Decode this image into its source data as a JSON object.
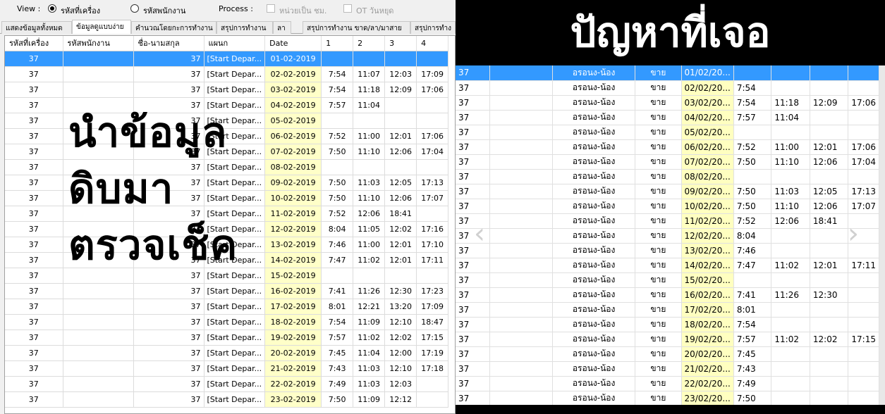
{
  "toolbar": {
    "view_label": "View :",
    "radio_machine": "รหัสที่เครื่อง",
    "radio_employee": "รหัสพนักงาน",
    "process_label": "Process :",
    "unit_hours": "หน่วยเป็น ชม.",
    "ot_holiday": "OT วันหยุด"
  },
  "tabs": [
    "แสดงข้อมูลทั้งหมด",
    "ข้อมูลดูแบบง่าย",
    "คำนวณโดยกะการทำงาน",
    "สรุปการทำงาน",
    "ลา",
    "สรุปการทำงาน ขาด/ลา/มาสาย",
    "สรุปการทำง"
  ],
  "grid": {
    "columns": [
      "รหัสที่เครื่อง",
      "รหัสพนักงาน",
      "ชื่อ-นามสกุล",
      "แผนก",
      "Date",
      "1",
      "2",
      "3",
      "4"
    ],
    "rows": [
      [
        "37",
        "",
        "37",
        "[Start Depar...",
        "01-02-2019",
        "",
        "",
        "",
        ""
      ],
      [
        "37",
        "",
        "37",
        "[Start Depar...",
        "02-02-2019",
        "7:54",
        "11:07",
        "12:03",
        "17:09"
      ],
      [
        "37",
        "",
        "37",
        "[Start Depar...",
        "03-02-2019",
        "7:54",
        "11:18",
        "12:09",
        "17:06"
      ],
      [
        "37",
        "",
        "37",
        "[Start Depar...",
        "04-02-2019",
        "7:57",
        "11:04",
        "",
        ""
      ],
      [
        "37",
        "",
        "37",
        "[Start Depar...",
        "05-02-2019",
        "",
        "",
        "",
        ""
      ],
      [
        "37",
        "",
        "37",
        "[Start Depar...",
        "06-02-2019",
        "7:52",
        "11:00",
        "12:01",
        "17:06"
      ],
      [
        "37",
        "",
        "37",
        "[Start Depar...",
        "07-02-2019",
        "7:50",
        "11:10",
        "12:06",
        "17:04"
      ],
      [
        "37",
        "",
        "37",
        "[Start Depar...",
        "08-02-2019",
        "",
        "",
        "",
        ""
      ],
      [
        "37",
        "",
        "37",
        "[Start Depar...",
        "09-02-2019",
        "7:50",
        "11:03",
        "12:05",
        "17:13"
      ],
      [
        "37",
        "",
        "37",
        "[Start Depar...",
        "10-02-2019",
        "7:50",
        "11:10",
        "12:06",
        "17:07"
      ],
      [
        "37",
        "",
        "37",
        "[Start Depar...",
        "11-02-2019",
        "7:52",
        "12:06",
        "18:41",
        ""
      ],
      [
        "37",
        "",
        "37",
        "[Start Depar...",
        "12-02-2019",
        "8:04",
        "11:05",
        "12:02",
        "17:16"
      ],
      [
        "37",
        "",
        "37",
        "[Start Depar...",
        "13-02-2019",
        "7:46",
        "11:00",
        "12:01",
        "17:10"
      ],
      [
        "37",
        "",
        "37",
        "[Start Depar...",
        "14-02-2019",
        "7:47",
        "11:02",
        "12:01",
        "17:11"
      ],
      [
        "37",
        "",
        "37",
        "[Start Depar...",
        "15-02-2019",
        "",
        "",
        "",
        ""
      ],
      [
        "37",
        "",
        "37",
        "[Start Depar...",
        "16-02-2019",
        "7:41",
        "11:26",
        "12:30",
        "17:23"
      ],
      [
        "37",
        "",
        "37",
        "[Start Depar...",
        "17-02-2019",
        "8:01",
        "12:21",
        "13:20",
        "17:09"
      ],
      [
        "37",
        "",
        "37",
        "[Start Depar...",
        "18-02-2019",
        "7:54",
        "11:09",
        "12:10",
        "18:47"
      ],
      [
        "37",
        "",
        "37",
        "[Start Depar...",
        "19-02-2019",
        "7:57",
        "11:02",
        "12:02",
        "17:15"
      ],
      [
        "37",
        "",
        "37",
        "[Start Depar...",
        "20-02-2019",
        "7:45",
        "11:04",
        "12:00",
        "17:19"
      ],
      [
        "37",
        "",
        "37",
        "[Start Depar...",
        "21-02-2019",
        "7:43",
        "11:03",
        "12:10",
        "17:18"
      ],
      [
        "37",
        "",
        "37",
        "[Start Depar...",
        "22-02-2019",
        "7:49",
        "11:03",
        "12:03",
        ""
      ],
      [
        "37",
        "",
        "37",
        "[Start Depar...",
        "23-02-2019",
        "7:50",
        "11:09",
        "12:12",
        ""
      ]
    ]
  },
  "overlay": {
    "line1": "นำข้อมูล",
    "line2": "ดิบมา",
    "line3": "ตรวจเช็ค"
  },
  "right": {
    "banner": "ปัญหาที่เจอ",
    "rows": [
      [
        "37",
        "",
        "อรอนง-น้อง",
        "ขาย",
        "01/02/20...",
        "",
        "",
        "",
        ""
      ],
      [
        "37",
        "",
        "อรอนง-น้อง",
        "ขาย",
        "02/02/20...",
        "7:54",
        "",
        "",
        ""
      ],
      [
        "37",
        "",
        "อรอนง-น้อง",
        "ขาย",
        "03/02/20...",
        "7:54",
        "11:18",
        "12:09",
        "17:06"
      ],
      [
        "37",
        "",
        "อรอนง-น้อง",
        "ขาย",
        "04/02/20...",
        "7:57",
        "11:04",
        "",
        ""
      ],
      [
        "37",
        "",
        "อรอนง-น้อง",
        "ขาย",
        "05/02/20...",
        "",
        "",
        "",
        ""
      ],
      [
        "37",
        "",
        "อรอนง-น้อง",
        "ขาย",
        "06/02/20...",
        "7:52",
        "11:00",
        "12:01",
        "17:06"
      ],
      [
        "37",
        "",
        "อรอนง-น้อง",
        "ขาย",
        "07/02/20...",
        "7:50",
        "11:10",
        "12:06",
        "17:04"
      ],
      [
        "37",
        "",
        "อรอนง-น้อง",
        "ขาย",
        "08/02/20...",
        "",
        "",
        "",
        ""
      ],
      [
        "37",
        "",
        "อรอนง-น้อง",
        "ขาย",
        "09/02/20...",
        "7:50",
        "11:03",
        "12:05",
        "17:13"
      ],
      [
        "37",
        "",
        "อรอนง-น้อง",
        "ขาย",
        "10/02/20...",
        "7:50",
        "11:10",
        "12:06",
        "17:07"
      ],
      [
        "37",
        "",
        "อรอนง-น้อง",
        "ขาย",
        "11/02/20...",
        "7:52",
        "12:06",
        "18:41",
        ""
      ],
      [
        "37",
        "",
        "อรอนง-น้อง",
        "ขาย",
        "12/02/20...",
        "8:04",
        "",
        "",
        ""
      ],
      [
        "37",
        "",
        "อรอนง-น้อง",
        "ขาย",
        "13/02/20...",
        "7:46",
        "",
        "",
        ""
      ],
      [
        "37",
        "",
        "อรอนง-น้อง",
        "ขาย",
        "14/02/20...",
        "7:47",
        "11:02",
        "12:01",
        "17:11"
      ],
      [
        "37",
        "",
        "อรอนง-น้อง",
        "ขาย",
        "15/02/20...",
        "",
        "",
        "",
        ""
      ],
      [
        "37",
        "",
        "อรอนง-น้อง",
        "ขาย",
        "16/02/20...",
        "7:41",
        "11:26",
        "12:30",
        ""
      ],
      [
        "37",
        "",
        "อรอนง-น้อง",
        "ขาย",
        "17/02/20...",
        "8:01",
        "",
        "",
        ""
      ],
      [
        "37",
        "",
        "อรอนง-น้อง",
        "ขาย",
        "18/02/20...",
        "7:54",
        "",
        "",
        ""
      ],
      [
        "37",
        "",
        "อรอนง-น้อง",
        "ขาย",
        "19/02/20...",
        "7:57",
        "11:02",
        "12:02",
        "17:15"
      ],
      [
        "37",
        "",
        "อรอนง-น้อง",
        "ขาย",
        "20/02/20...",
        "7:45",
        "",
        "",
        ""
      ],
      [
        "37",
        "",
        "อรอนง-น้อง",
        "ขาย",
        "21/02/20...",
        "7:43",
        "",
        "",
        ""
      ],
      [
        "37",
        "",
        "อรอนง-น้อง",
        "ขาย",
        "22/02/20...",
        "7:49",
        "",
        "",
        ""
      ],
      [
        "37",
        "",
        "อรอนง-น้อง",
        "ขาย",
        "23/02/20...",
        "7:50",
        "",
        "",
        ""
      ]
    ]
  },
  "icons": {
    "prev": "chevron-left-icon",
    "next": "chevron-right-icon",
    "prev_glyph": "‹",
    "next_glyph": "›"
  },
  "colors": {
    "selection": "#3399ff",
    "date_highlight": "#ffffc8"
  }
}
